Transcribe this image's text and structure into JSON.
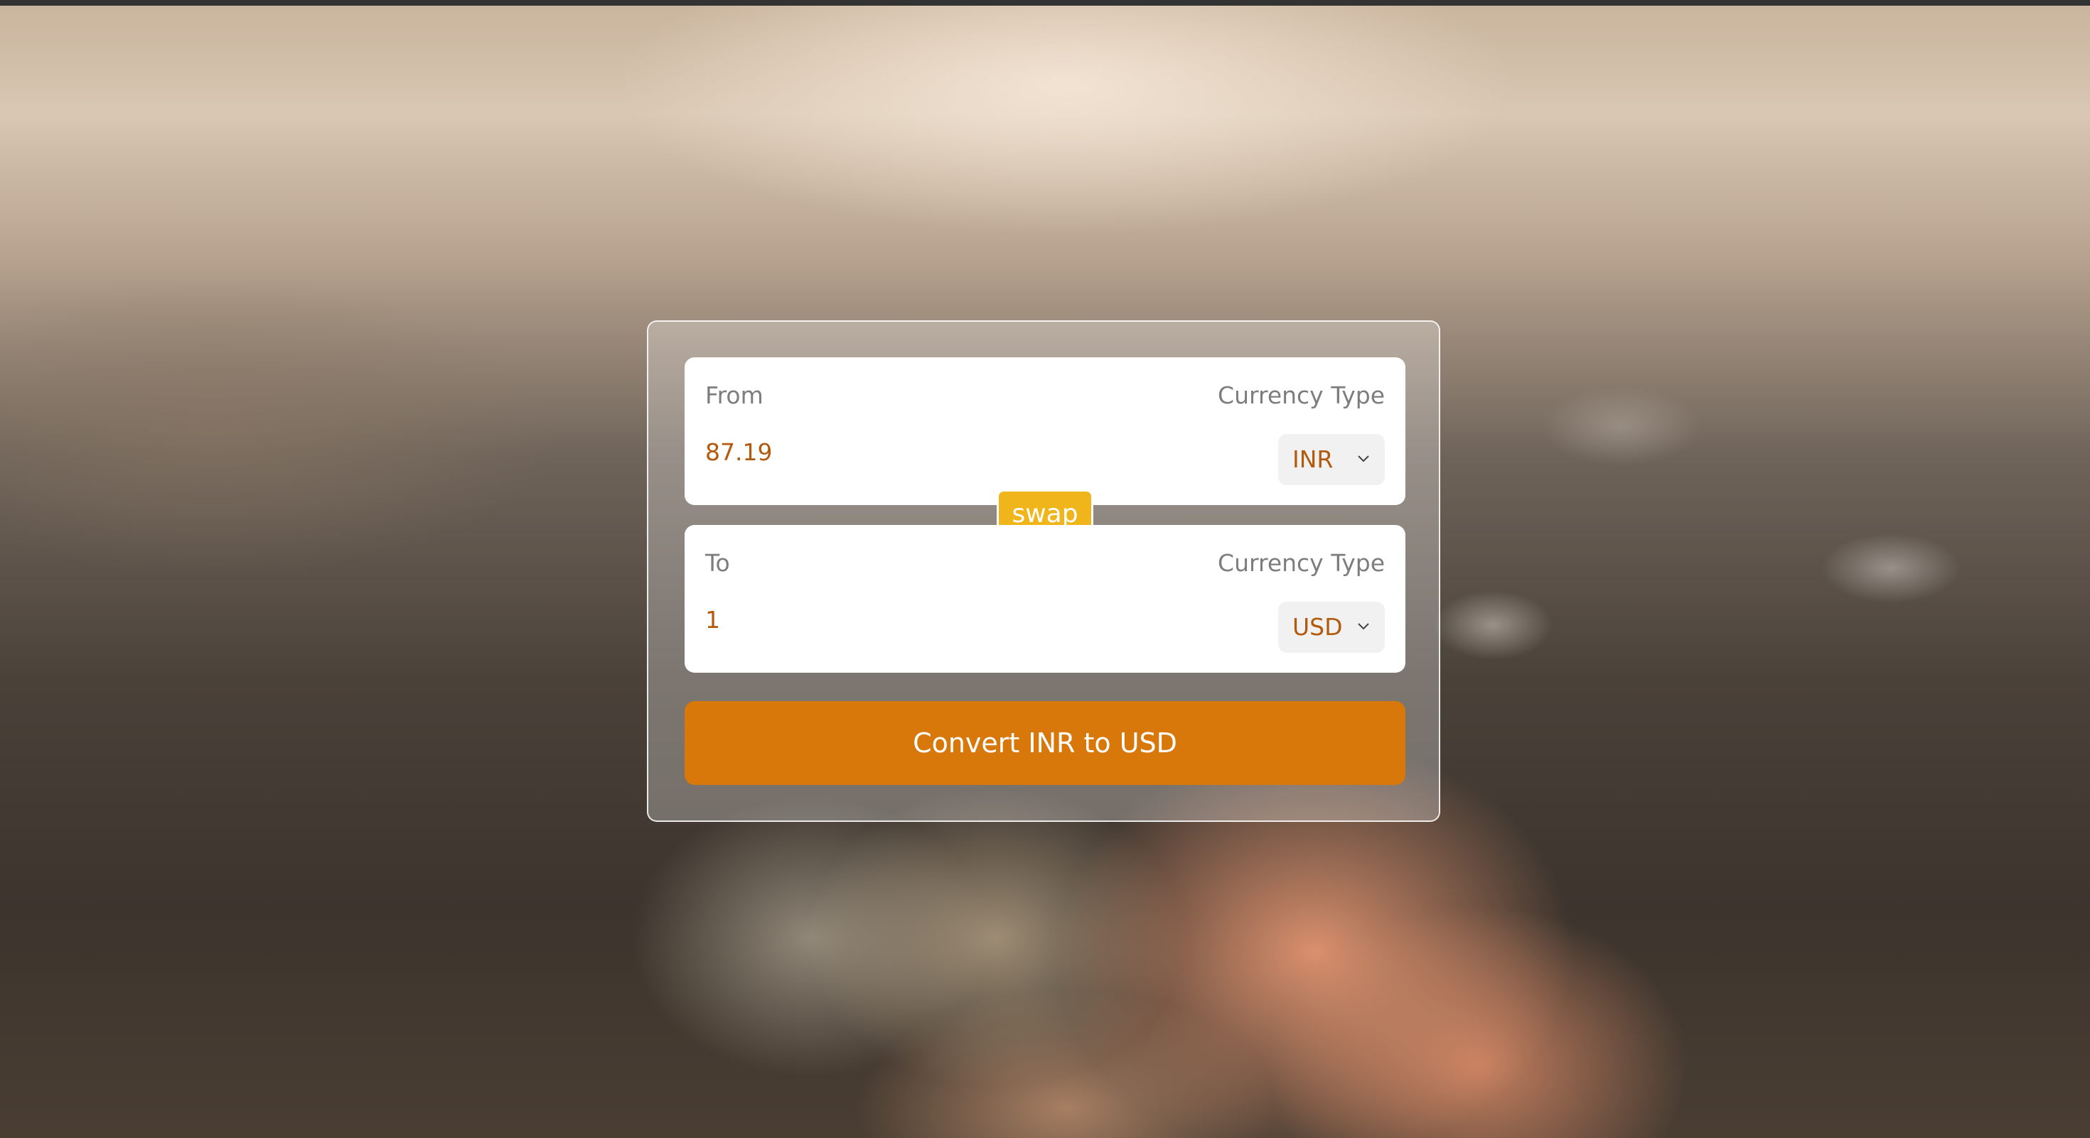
{
  "from": {
    "label": "From",
    "type_label": "Currency Type",
    "amount": "87.19",
    "currency": "INR"
  },
  "to": {
    "label": "To",
    "type_label": "Currency Type",
    "amount": "1",
    "currency": "USD"
  },
  "swap_label": "swap",
  "convert_label": "Convert INR to USD",
  "colors": {
    "accent": "#d8770a",
    "swap": "#f0b51b",
    "value_text": "#b25a0e"
  }
}
